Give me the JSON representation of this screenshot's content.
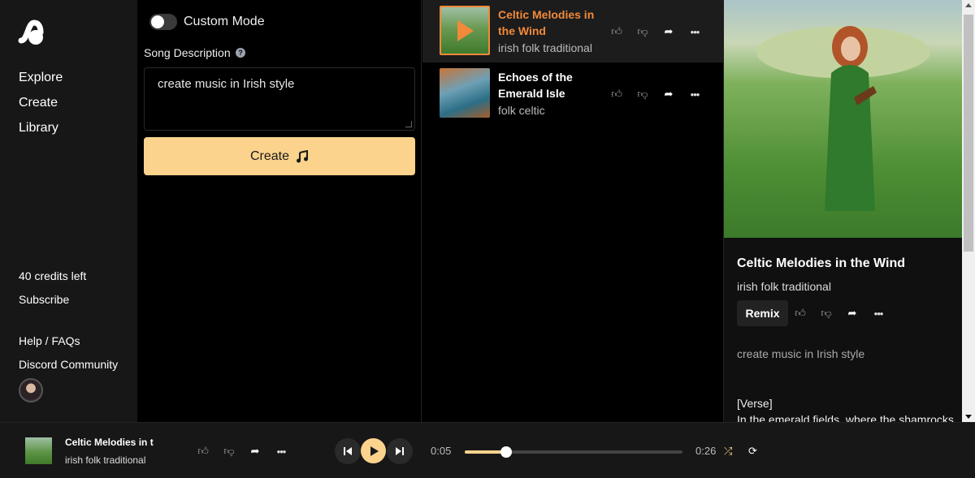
{
  "sidebar": {
    "nav": [
      "Explore",
      "Create",
      "Library"
    ],
    "credits": "40 credits left",
    "subscribe": "Subscribe",
    "help": "Help / FAQs",
    "discord": "Discord Community"
  },
  "create": {
    "custom_mode_label": "Custom Mode",
    "custom_mode_on": false,
    "song_description_label": "Song Description",
    "description_value": "create music in Irish style",
    "create_button": "Create"
  },
  "songs": [
    {
      "title": "Celtic Melodies in the Wind",
      "tags": "irish folk traditional",
      "active": true
    },
    {
      "title": "Echoes of the Emerald Isle",
      "tags": "folk celtic",
      "active": false
    }
  ],
  "detail": {
    "title": "Celtic Melodies in the Wind",
    "tags": "irish folk traditional",
    "remix": "Remix",
    "prompt": "create music in Irish style",
    "lyrics_tag": "[Verse]",
    "lyrics_line": "In the emerald fields, where the shamrocks"
  },
  "player": {
    "title": "Celtic Melodies in t",
    "tags": "irish folk traditional",
    "current_time": "0:05",
    "total_time": "0:26",
    "progress": 0.19
  },
  "colors": {
    "accent": "#fcd38d",
    "active_title": "#f18a3a",
    "background": "#000000",
    "sidebar": "#171717"
  },
  "icons": [
    "thumbs-up-icon",
    "thumbs-down-icon",
    "share-icon",
    "more-icon",
    "music-note-icon",
    "help-icon",
    "skip-back-icon",
    "play-icon",
    "skip-forward-icon",
    "shuffle-icon",
    "repeat-icon"
  ]
}
